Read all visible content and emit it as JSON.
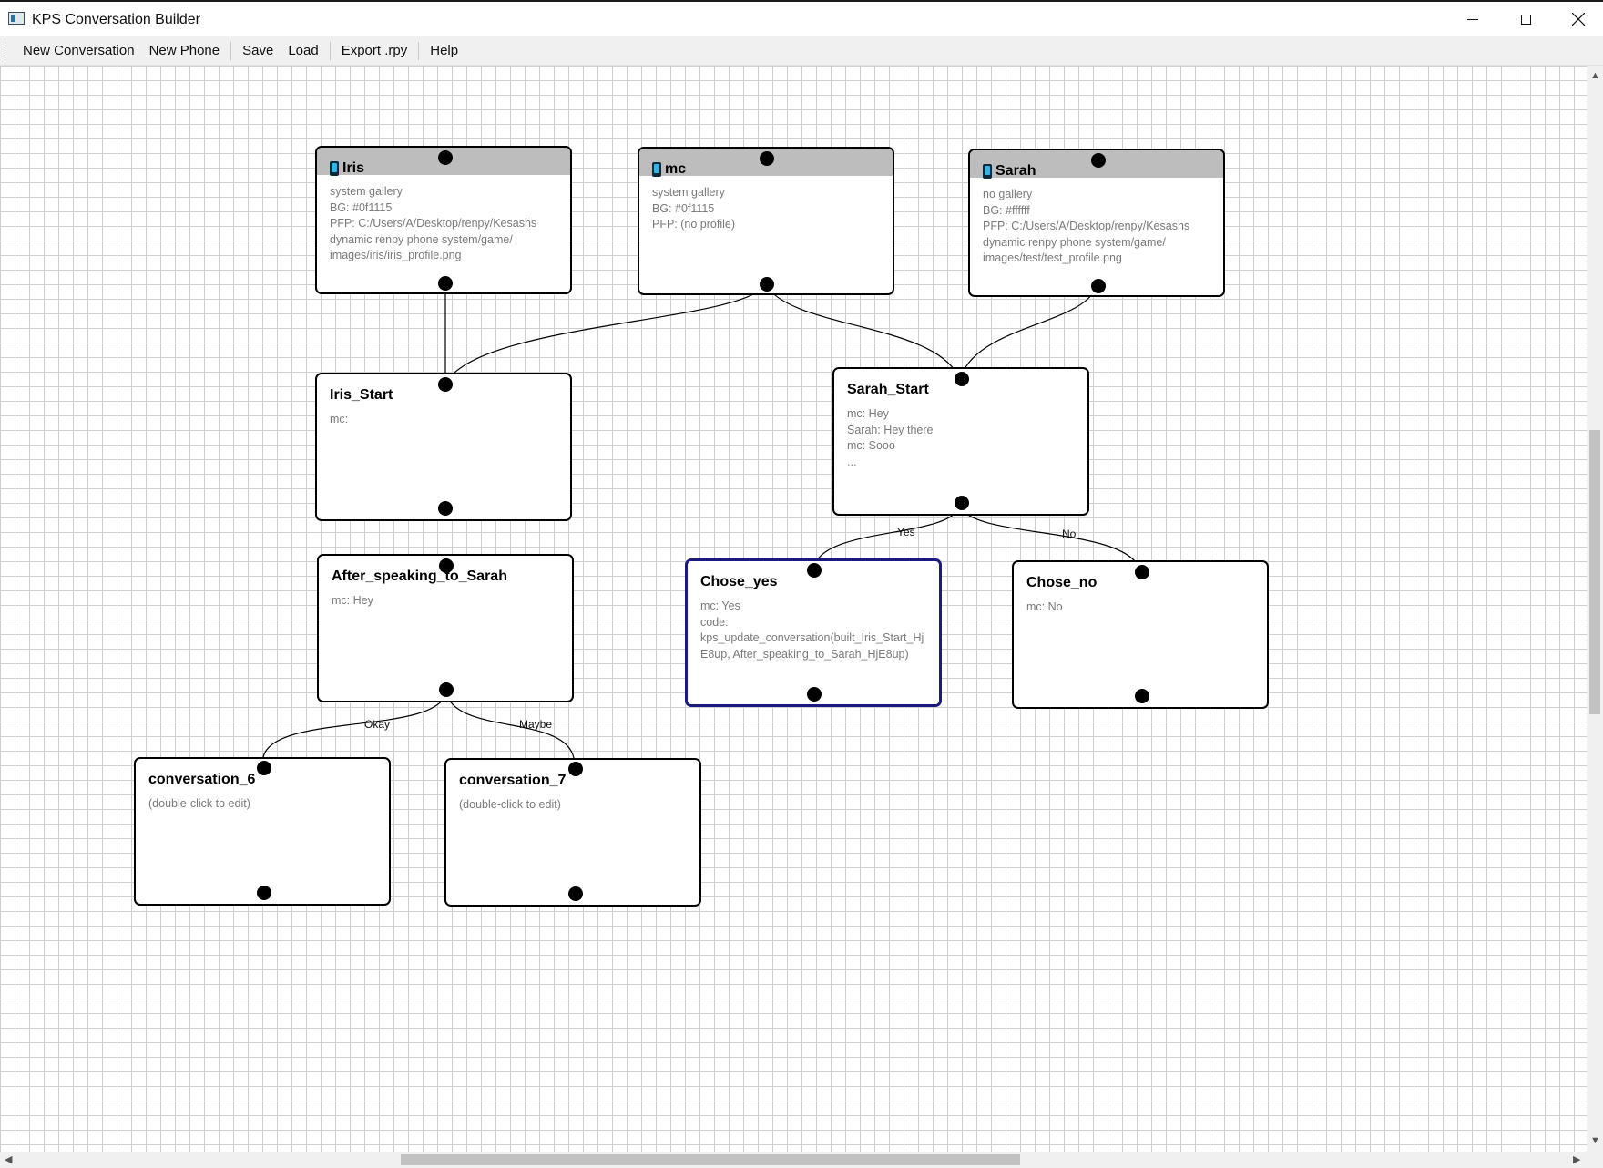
{
  "window": {
    "title": "KPS Conversation Builder",
    "icons": {
      "app": "app-icon",
      "minimize": "minimize-icon",
      "maximize": "maximize-icon",
      "close": "close-icon"
    }
  },
  "menu": [
    {
      "label": "New Conversation"
    },
    {
      "label": "New Phone"
    },
    {
      "label": "Save"
    },
    {
      "label": "Load"
    },
    {
      "label": "Export .rpy"
    },
    {
      "label": "Help"
    }
  ],
  "canvas": {
    "grid_color": "#cfcfcf",
    "selection_color": "#1a1a80",
    "phone_header_color": "#bdbdbd"
  },
  "phones": [
    {
      "name": "Iris",
      "icon": "phone-icon",
      "details": "system gallery\nBG: #0f1115\nPFP: C:/Users/A/Desktop/renpy/Kesashs\ndynamic renpy phone system/game/\nimages/iris/iris_profile.png"
    },
    {
      "name": "mc",
      "icon": "phone-icon",
      "details": "system gallery\nBG: #0f1115\nPFP: (no profile)"
    },
    {
      "name": "Sarah",
      "icon": "phone-icon",
      "details": "no gallery\nBG: #ffffff\nPFP: C:/Users/A/Desktop/renpy/Kesashs\ndynamic renpy phone system/game/\nimages/test/test_profile.png"
    }
  ],
  "conversations": [
    {
      "name": "Iris_Start",
      "details": "mc:"
    },
    {
      "name": "Sarah_Start",
      "details": "mc: Hey\nSarah: Hey there\nmc: Sooo\n..."
    },
    {
      "name": "After_speaking_to_Sarah",
      "details": "mc: Hey"
    },
    {
      "name": "Chose_yes",
      "details": "mc: Yes\ncode:\nkps_update_conversation(built_Iris_Start_Hj\nE8up, After_speaking_to_Sarah_HjE8up)",
      "selected": true
    },
    {
      "name": "Chose_no",
      "details": "mc: No"
    },
    {
      "name": "conversation_6",
      "details": "(double-click to edit)"
    },
    {
      "name": "conversation_7",
      "details": "(double-click to edit)"
    }
  ],
  "edge_labels": {
    "yes": "Yes",
    "no": "No",
    "okay": "Okay",
    "maybe": "Maybe"
  }
}
